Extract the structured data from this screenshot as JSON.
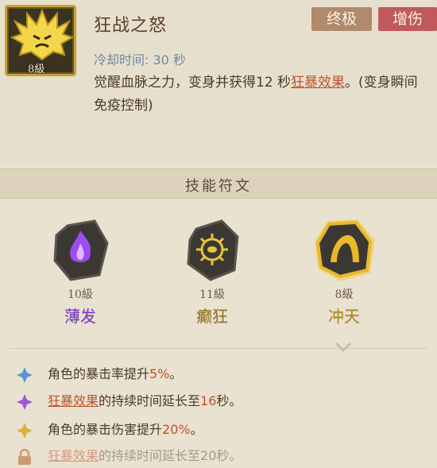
{
  "skill": {
    "level_badge": "8級",
    "title": "狂战之怒",
    "tags": [
      "终极",
      "增伤"
    ],
    "cooldown": "冷却时间: 30 秒",
    "description_a": "觉醒血脉之力，变身并获得12 秒",
    "description_link": "狂暴效果",
    "description_b": "。(变身瞬间免疫控制)"
  },
  "runes_section": {
    "title": "技能符文"
  },
  "runes": [
    {
      "level": "10級",
      "name": "薄发",
      "color": "#7a35c7"
    },
    {
      "level": "11級",
      "name": "癫狂",
      "color": "#9a7118"
    },
    {
      "level": "8級",
      "name": "冲天",
      "color": "#b58613"
    }
  ],
  "effects": [
    {
      "icon": "blue-diamond-icon",
      "pre": "角色的暴击率提升",
      "value": "5%",
      "post": "。"
    },
    {
      "icon": "purple-diamond-icon",
      "link": "狂暴效果",
      "pre": "的持续时间延长至",
      "value": "16",
      "post": "秒。"
    },
    {
      "icon": "gold-diamond-icon",
      "pre": "角色的暴击伤害提升",
      "value": "20%",
      "post": "。"
    },
    {
      "icon": "lock-icon",
      "link": "狂暴效果",
      "pre": "的持续时间延长至",
      "value": "20",
      "post": "秒。"
    }
  ]
}
